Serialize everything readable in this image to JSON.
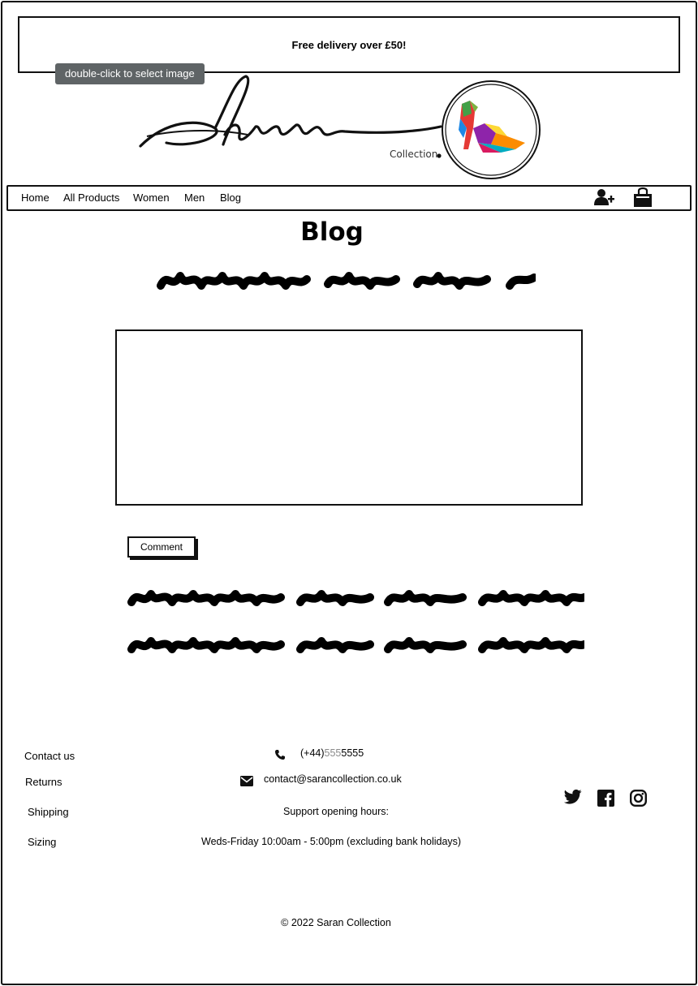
{
  "banner": {
    "text": "Free delivery over £50!"
  },
  "editor": {
    "tooltip": "double-click to select image"
  },
  "logo": {
    "script_text": "Saran",
    "caption": "Collection"
  },
  "nav": {
    "items": [
      "Home",
      "All Products",
      "Women",
      "Men",
      "Blog"
    ],
    "icons": [
      "add-user-icon",
      "shopping-bag-icon"
    ]
  },
  "page": {
    "title": "Blog"
  },
  "comment": {
    "button_label": "Comment"
  },
  "footer": {
    "links": [
      "Contact us",
      "Returns",
      "Shipping",
      "Sizing"
    ],
    "phone_prefix": "(+44)",
    "phone_mid": "555",
    "phone_suffix": "5555",
    "email": "contact@sarancollection.co.uk",
    "hours_title": "Support opening hours:",
    "hours": "Weds-Friday 10:00am - 5:00pm (excluding bank holidays)",
    "social": [
      "twitter-icon",
      "facebook-icon",
      "instagram-icon"
    ],
    "copyright": "© 2022 Saran Collection"
  },
  "colors": {
    "ink": "#111111",
    "tooltip_bg": "#5f6466",
    "muted": "#8a8a8a"
  }
}
